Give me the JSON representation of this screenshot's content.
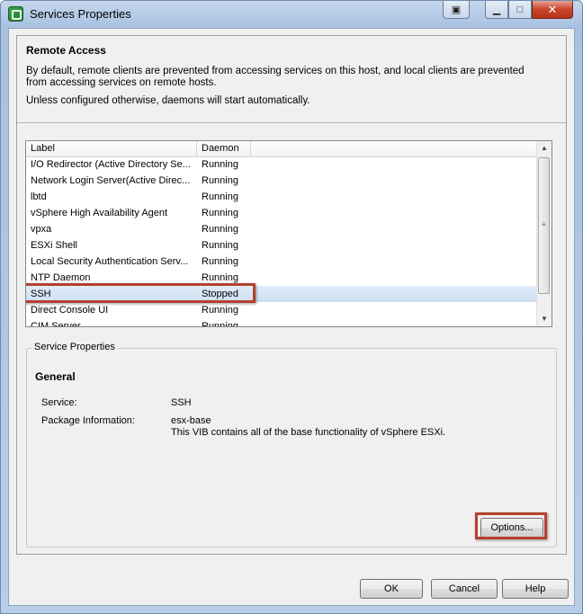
{
  "window": {
    "title": "Services Properties",
    "close_glyph": "✕",
    "minimize_glyph": "▁",
    "maximize_glyph": "□",
    "extra_glyph": "▣"
  },
  "remote_access": {
    "heading": "Remote Access",
    "description": "By default, remote clients are prevented from accessing services on this host, and local clients are prevented from accessing services on remote hosts.",
    "daemons_note": "Unless configured otherwise, daemons will start automatically."
  },
  "services_table": {
    "columns": [
      "Label",
      "Daemon"
    ],
    "rows": [
      {
        "label": "I/O Redirector (Active Directory Se...",
        "daemon": "Running"
      },
      {
        "label": "Network Login Server(Active Direc...",
        "daemon": "Running"
      },
      {
        "label": "lbtd",
        "daemon": "Running"
      },
      {
        "label": "vSphere High Availability Agent",
        "daemon": "Running"
      },
      {
        "label": "vpxa",
        "daemon": "Running"
      },
      {
        "label": "ESXi Shell",
        "daemon": "Running"
      },
      {
        "label": "Local Security Authentication Serv...",
        "daemon": "Running"
      },
      {
        "label": "NTP Daemon",
        "daemon": "Running"
      },
      {
        "label": "SSH",
        "daemon": "Stopped"
      },
      {
        "label": "Direct Console UI",
        "daemon": "Running"
      },
      {
        "label": "CIM Server",
        "daemon": "Running"
      }
    ],
    "selected_index": 8
  },
  "service_properties": {
    "group_title": "Service Properties",
    "section": "General",
    "service_label": "Service:",
    "service_value": "SSH",
    "package_label": "Package Information:",
    "package_value": "esx-base",
    "package_desc": "This VIB contains all of the base functionality of vSphere ESXi.",
    "options_button": "Options..."
  },
  "buttons": {
    "ok": "OK",
    "cancel": "Cancel",
    "help": "Help"
  }
}
